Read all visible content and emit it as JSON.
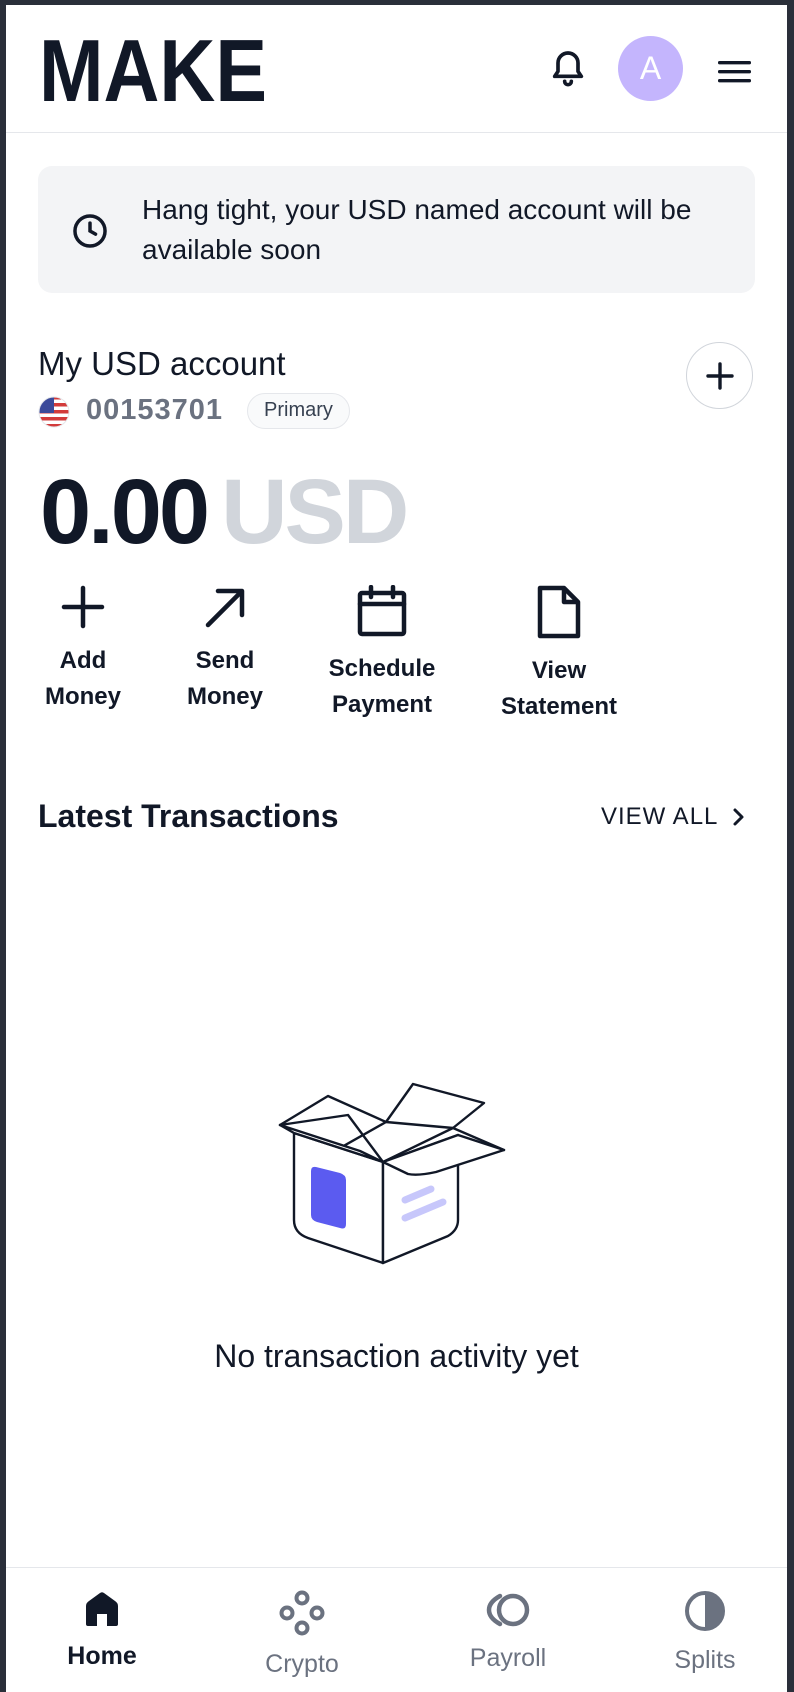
{
  "header": {
    "logo_text": "MAKE",
    "avatar_initial": "A"
  },
  "banner": {
    "text": "Hang tight, your USD named account will be available soon"
  },
  "account": {
    "title": "My USD account",
    "number": "00153701",
    "badge": "Primary",
    "balance_amount": "0.00",
    "balance_currency": "USD"
  },
  "actions": [
    {
      "line1": "Add",
      "line2": "Money"
    },
    {
      "line1": "Send",
      "line2": "Money"
    },
    {
      "line1": "Schedule",
      "line2": "Payment"
    },
    {
      "line1": "View",
      "line2": "Statement"
    }
  ],
  "transactions": {
    "title": "Latest Transactions",
    "view_all": "VIEW ALL",
    "empty_text": "No transaction activity yet"
  },
  "nav": [
    {
      "label": "Home",
      "icon": "home-icon",
      "active": true
    },
    {
      "label": "Crypto",
      "icon": "crypto-icon",
      "active": false
    },
    {
      "label": "Payroll",
      "icon": "payroll-icon",
      "active": false
    },
    {
      "label": "Splits",
      "icon": "splits-icon",
      "active": false
    }
  ],
  "colors": {
    "primary_text": "#111827",
    "muted_text": "#6b7280",
    "avatar_bg": "#c4b5fd",
    "accent": "#5b5bf0"
  }
}
